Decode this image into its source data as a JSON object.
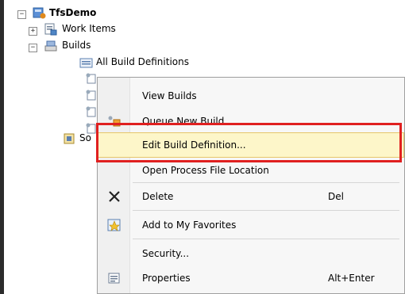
{
  "tree": {
    "root": {
      "label": "TfsDemo",
      "expander": "⊟"
    },
    "work_items": {
      "label": "Work Items",
      "expander": "+"
    },
    "builds": {
      "label": "Builds",
      "expander": "−"
    },
    "all_build_definitions": {
      "label": "All Build Definitions"
    },
    "partial_sibling": {
      "label": "So"
    }
  },
  "context_menu": {
    "items": [
      {
        "label": "View Builds",
        "shortcut": ""
      },
      {
        "label": "Queue New Build...",
        "shortcut": "",
        "icon": "queue-build-icon"
      },
      {
        "label": "Edit Build Definition...",
        "shortcut": "",
        "highlighted": true
      },
      {
        "label": "Open Process File Location",
        "shortcut": ""
      },
      {
        "label": "Delete",
        "shortcut": "Del",
        "icon": "delete-x-icon"
      },
      {
        "label": "Add to My Favorites",
        "shortcut": "",
        "icon": "favorites-star-icon"
      },
      {
        "label": "Security...",
        "shortcut": ""
      },
      {
        "label": "Properties",
        "shortcut": "Alt+Enter",
        "icon": "properties-icon"
      }
    ]
  },
  "colors": {
    "annotation_border": "#e02020",
    "menu_highlight": "#fdf6c9",
    "menu_background": "#f7f7f7"
  }
}
